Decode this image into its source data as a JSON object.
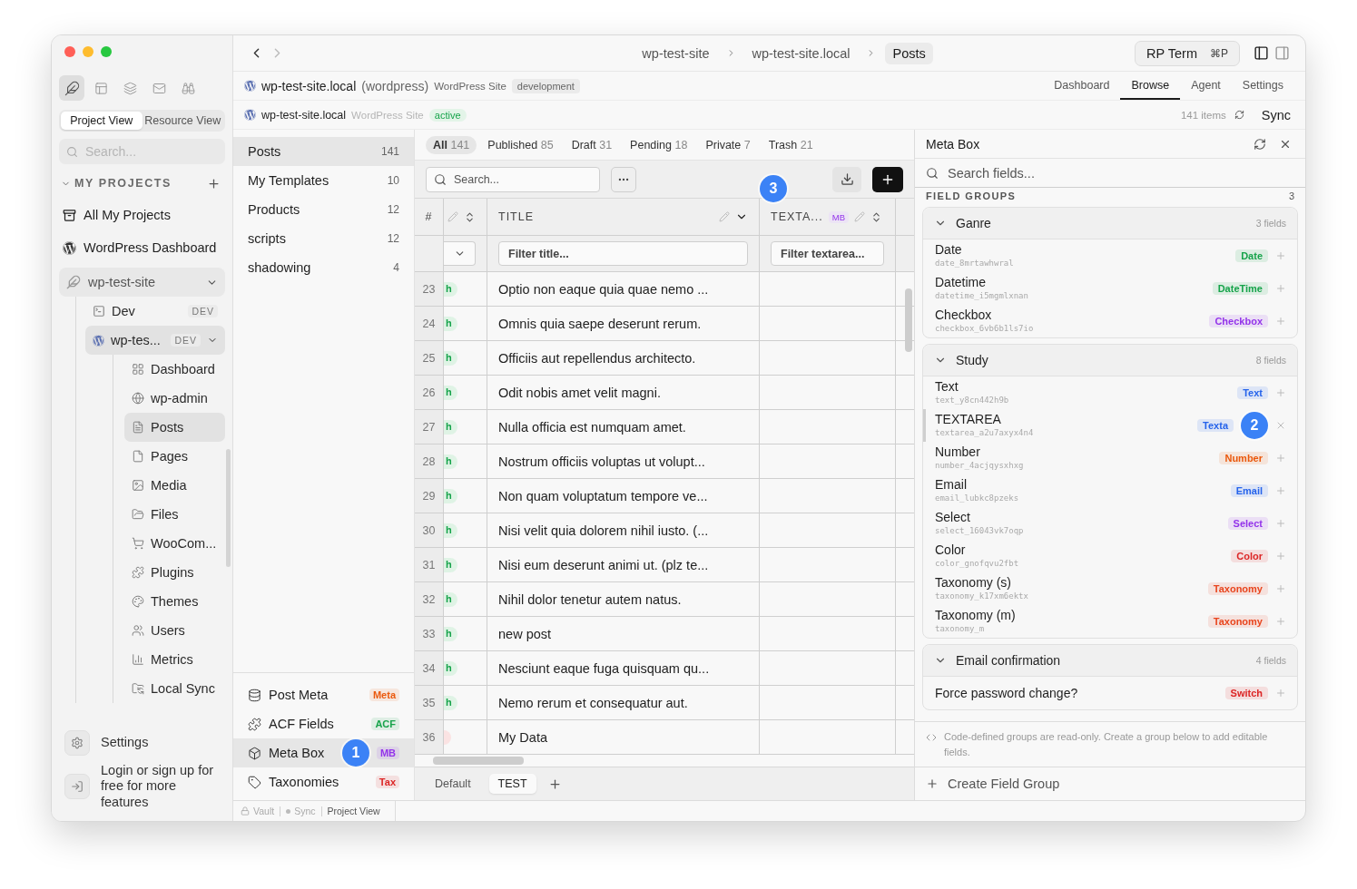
{
  "sidebar": {
    "tools": [
      {
        "kind": "feather",
        "selected": true
      },
      {
        "kind": "layout",
        "selected": false
      },
      {
        "kind": "layers",
        "selected": false
      },
      {
        "kind": "mail",
        "selected": false
      },
      {
        "kind": "binoculars",
        "selected": false
      }
    ],
    "view_switch": [
      {
        "label": "Project View",
        "selected": true
      },
      {
        "label": "Resource View",
        "selected": false
      }
    ],
    "search": {
      "placeholder": "Search..."
    },
    "section": {
      "title": "MY PROJECTS",
      "expanded": true
    },
    "links": [
      {
        "kind": "projects",
        "label": "All My Projects"
      },
      {
        "kind": "wordpress",
        "label": "WordPress Dashboard"
      }
    ],
    "project": {
      "label": "wp-test-site",
      "expanded": true,
      "children": [
        {
          "kind": "terminal",
          "label": "Dev",
          "badge": "DEV",
          "selected": false
        },
        {
          "kind": "wordpress",
          "label": "wp-tes...",
          "badge": "DEV",
          "selected": true,
          "expanded": true,
          "children": [
            {
              "kind": "dashboard",
              "label": "Dashboard",
              "selected": false
            },
            {
              "kind": "globe",
              "label": "wp-admin",
              "selected": false
            },
            {
              "kind": "posts",
              "label": "Posts",
              "selected": true
            },
            {
              "kind": "page",
              "label": "Pages",
              "selected": false
            },
            {
              "kind": "media",
              "label": "Media",
              "selected": false
            },
            {
              "kind": "files",
              "label": "Files",
              "selected": false
            },
            {
              "kind": "cart",
              "label": "WooCom...",
              "selected": false
            },
            {
              "kind": "plugin",
              "label": "Plugins",
              "selected": false
            },
            {
              "kind": "palette",
              "label": "Themes",
              "selected": false
            },
            {
              "kind": "users",
              "label": "Users",
              "selected": false
            },
            {
              "kind": "chart",
              "label": "Metrics",
              "selected": false
            },
            {
              "kind": "sync",
              "label": "Local Sync",
              "selected": false
            }
          ]
        }
      ]
    },
    "settings": "Settings",
    "login": "Login or sign up for free for more features"
  },
  "topbar": {
    "breadcrumb": [
      {
        "label": "wp-test-site",
        "selected": false
      },
      {
        "label": "wp-test-site.local",
        "selected": false
      },
      {
        "label": "Posts",
        "selected": true
      }
    ],
    "command": {
      "label": "RP Term",
      "shortcut": "⌘P"
    }
  },
  "site": {
    "name": "wp-test-site.local",
    "note": "(wordpress)",
    "kind_label": "WordPress Site",
    "env": "development"
  },
  "nav_tabs": [
    {
      "label": "Dashboard",
      "selected": false
    },
    {
      "label": "Browse",
      "selected": true
    },
    {
      "label": "Agent",
      "selected": false
    },
    {
      "label": "Settings",
      "selected": false
    }
  ],
  "connection": {
    "name": "wp-test-site.local",
    "kind_label": "WordPress Site",
    "status": "active",
    "count": "141 items",
    "sync": "Sync"
  },
  "post_types": [
    {
      "label": "Posts",
      "count": "141",
      "selected": true
    },
    {
      "label": "My Templates",
      "count": "10",
      "selected": false
    },
    {
      "label": "Products",
      "count": "12",
      "selected": false
    },
    {
      "label": "scripts",
      "count": "12",
      "selected": false
    },
    {
      "label": "shadowing",
      "count": "4",
      "selected": false
    }
  ],
  "sources": [
    {
      "kind": "meta",
      "label": "Post Meta",
      "tag": "Meta",
      "color": "#ea580c",
      "selected": false
    },
    {
      "kind": "acf",
      "label": "ACF Fields",
      "tag": "ACF",
      "color": "#16a34a",
      "selected": false
    },
    {
      "kind": "metabox",
      "label": "Meta Box",
      "tag": "MB",
      "color": "#9333ea",
      "selected": true,
      "marker": "1"
    },
    {
      "kind": "taxonomy",
      "label": "Taxonomies",
      "tag": "Tax",
      "color": "#dc2626",
      "selected": false
    }
  ],
  "table": {
    "status_tabs": [
      {
        "label": "All",
        "count": "141",
        "selected": true
      },
      {
        "label": "Published",
        "count": "85",
        "selected": false
      },
      {
        "label": "Draft",
        "count": "31",
        "selected": false
      },
      {
        "label": "Pending",
        "count": "18",
        "selected": false
      },
      {
        "label": "Private",
        "count": "7",
        "selected": false
      },
      {
        "label": "Trash",
        "count": "21",
        "selected": false
      }
    ],
    "search": {
      "placeholder": "Search..."
    },
    "columns": [
      {
        "kind": "index",
        "label": "#"
      },
      {
        "kind": "status"
      },
      {
        "kind": "title",
        "label": "TITLE",
        "filter_placeholder": "Filter title..."
      },
      {
        "kind": "meta",
        "label": "TEXTA...",
        "tag": "MB",
        "filter_placeholder": "Filter textarea...",
        "marker": "3"
      }
    ],
    "rows": [
      {
        "index": "23",
        "status": {
          "kind": "publish",
          "text": "h"
        },
        "title": "Optio non eaque quia quae nemo ..."
      },
      {
        "index": "24",
        "status": {
          "kind": "publish",
          "text": "h"
        },
        "title": "Omnis quia saepe deserunt rerum."
      },
      {
        "index": "25",
        "status": {
          "kind": "publish",
          "text": "h"
        },
        "title": "Officiis aut repellendus architecto."
      },
      {
        "index": "26",
        "status": {
          "kind": "publish",
          "text": "h"
        },
        "title": "Odit nobis amet velit magni."
      },
      {
        "index": "27",
        "status": {
          "kind": "publish",
          "text": "h"
        },
        "title": "Nulla officia est numquam amet."
      },
      {
        "index": "28",
        "status": {
          "kind": "publish",
          "text": "h"
        },
        "title": "Nostrum officiis voluptas ut volupt..."
      },
      {
        "index": "29",
        "status": {
          "kind": "publish",
          "text": "h"
        },
        "title": "Non quam voluptatum tempore ve..."
      },
      {
        "index": "30",
        "status": {
          "kind": "publish",
          "text": "h"
        },
        "title": "Nisi velit quia dolorem nihil iusto. (..."
      },
      {
        "index": "31",
        "status": {
          "kind": "publish",
          "text": "h"
        },
        "title": "Nisi eum deserunt animi ut. (plz te..."
      },
      {
        "index": "32",
        "status": {
          "kind": "publish",
          "text": "h"
        },
        "title": "Nihil dolor tenetur autem natus."
      },
      {
        "index": "33",
        "status": {
          "kind": "publish",
          "text": "h"
        },
        "title": "new post"
      },
      {
        "index": "34",
        "status": {
          "kind": "publish",
          "text": "h"
        },
        "title": "Nesciunt eaque fuga quisquam qu..."
      },
      {
        "index": "35",
        "status": {
          "kind": "publish",
          "text": "h"
        },
        "title": "Nemo rerum et consequatur aut."
      },
      {
        "index": "36",
        "status": {
          "kind": "draft"
        },
        "title": "My Data"
      }
    ],
    "views": [
      {
        "label": "Default",
        "selected": false
      },
      {
        "label": "TEST",
        "selected": true
      }
    ]
  },
  "meta_panel": {
    "title": "Meta Box",
    "search_placeholder": "Search fields...",
    "section": "FIELD GROUPS",
    "count": "3",
    "groups": [
      {
        "name": "Ganre",
        "count": "3 fields",
        "expanded": true,
        "fields": [
          {
            "label": "Date",
            "key": "date_8mrtawhwral",
            "type": "Date",
            "color": "#16a34a",
            "selected": false
          },
          {
            "label": "Datetime",
            "key": "datetime_i5mgmlxnan",
            "type": "DateTime",
            "color": "#16a34a",
            "selected": false
          },
          {
            "label": "Checkbox",
            "key": "checkbox_6vb6b1ls7io",
            "type": "Checkbox",
            "color": "#9333ea",
            "selected": false
          }
        ]
      },
      {
        "name": "Study",
        "count": "8 fields",
        "expanded": true,
        "fields": [
          {
            "label": "Text",
            "key": "text_y8cn442h9b",
            "type": "Text",
            "color": "#2563eb",
            "selected": false
          },
          {
            "label": "TEXTAREA",
            "key": "textarea_a2u7axyx4n4",
            "type": "Texta",
            "color": "#2563eb",
            "selected": true,
            "marker": "2"
          },
          {
            "label": "Number",
            "key": "number_4acjqysxhxg",
            "type": "Number",
            "color": "#ea580c",
            "selected": false
          },
          {
            "label": "Email",
            "key": "email_lubkc8pzeks",
            "type": "Email",
            "color": "#2563eb",
            "selected": false
          },
          {
            "label": "Select",
            "key": "select_16043vk7oqp",
            "type": "Select",
            "color": "#9333ea",
            "selected": false
          },
          {
            "label": "Color",
            "key": "color_gnofqvu2fbt",
            "type": "Color",
            "color": "#dc2626",
            "selected": false
          },
          {
            "label": "Taxonomy (s)",
            "key": "taxonomy_k17xm6ektx",
            "type": "Taxonomy",
            "color": "#e8451e",
            "selected": false
          },
          {
            "label": "Taxonomy (m)",
            "key": "taxonomy_m",
            "type": "Taxonomy",
            "color": "#e8451e",
            "selected": false
          }
        ]
      },
      {
        "name": "Email confirmation",
        "count": "4 fields",
        "expanded": true,
        "fields": [
          {
            "label": "Force password change?",
            "type": "Switch",
            "color": "#dc2626",
            "selected": false
          }
        ]
      }
    ],
    "note": "Code-defined groups are read-only. Create a group below to add editable fields.",
    "create": "Create Field Group"
  },
  "status_bar": [
    {
      "kind": "lock",
      "label": "Vault"
    },
    {
      "kind": "dot",
      "label": "Sync"
    },
    {
      "kind": "plain",
      "label": "Project View"
    }
  ]
}
